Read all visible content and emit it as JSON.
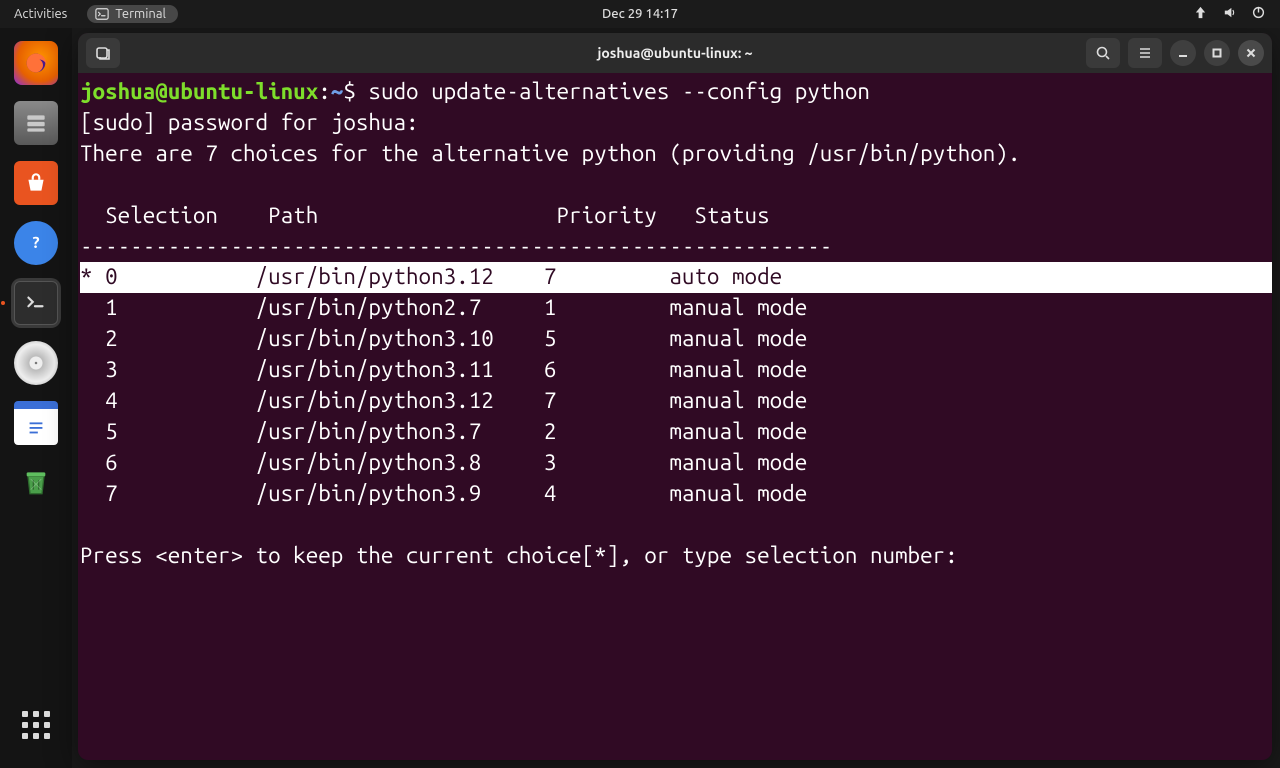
{
  "topbar": {
    "activities": "Activities",
    "app_name": "Terminal",
    "clock": "Dec 29  14:17"
  },
  "dock": {
    "items": [
      {
        "name": "firefox"
      },
      {
        "name": "files"
      },
      {
        "name": "software"
      },
      {
        "name": "help"
      },
      {
        "name": "terminal"
      },
      {
        "name": "disks"
      },
      {
        "name": "text-editor"
      },
      {
        "name": "trash"
      }
    ]
  },
  "window": {
    "title": "joshua@ubuntu-linux: ~"
  },
  "terminal": {
    "prompt_user_host": "joshua@ubuntu-linux",
    "prompt_sep": ":",
    "prompt_path": "~",
    "prompt_end": "$ ",
    "command": "sudo update-alternatives --config python",
    "sudo_line": "[sudo] password for joshua:",
    "intro_line": "There are 7 choices for the alternative python (providing /usr/bin/python).",
    "header": "  Selection    Path                   Priority   Status",
    "divider": "------------------------------------------------------------",
    "rows": [
      {
        "star": "*",
        "sel": "0",
        "path": "/usr/bin/python3.12",
        "priority": "7",
        "status": "auto mode",
        "highlighted": true
      },
      {
        "star": " ",
        "sel": "1",
        "path": "/usr/bin/python2.7",
        "priority": "1",
        "status": "manual mode",
        "highlighted": false
      },
      {
        "star": " ",
        "sel": "2",
        "path": "/usr/bin/python3.10",
        "priority": "5",
        "status": "manual mode",
        "highlighted": false
      },
      {
        "star": " ",
        "sel": "3",
        "path": "/usr/bin/python3.11",
        "priority": "6",
        "status": "manual mode",
        "highlighted": false
      },
      {
        "star": " ",
        "sel": "4",
        "path": "/usr/bin/python3.12",
        "priority": "7",
        "status": "manual mode",
        "highlighted": false
      },
      {
        "star": " ",
        "sel": "5",
        "path": "/usr/bin/python3.7",
        "priority": "2",
        "status": "manual mode",
        "highlighted": false
      },
      {
        "star": " ",
        "sel": "6",
        "path": "/usr/bin/python3.8",
        "priority": "3",
        "status": "manual mode",
        "highlighted": false
      },
      {
        "star": " ",
        "sel": "7",
        "path": "/usr/bin/python3.9",
        "priority": "4",
        "status": "manual mode",
        "highlighted": false
      }
    ],
    "footer": "Press <enter> to keep the current choice[*], or type selection number:"
  }
}
